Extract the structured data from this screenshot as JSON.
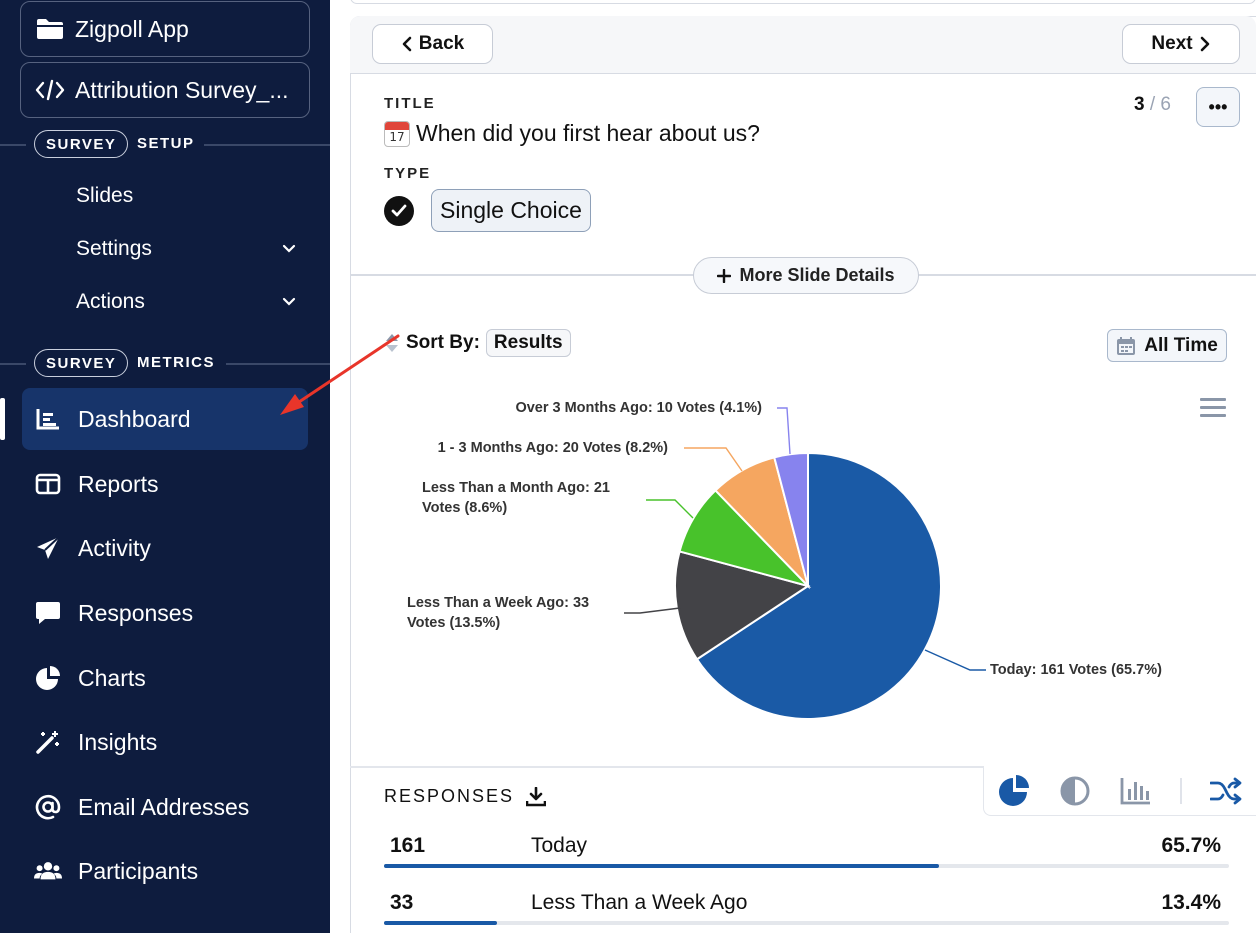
{
  "sidebar": {
    "app_name": "Zigpoll App",
    "survey_name": "Attribution Survey_...",
    "setup_section": {
      "pill": "SURVEY",
      "label": "SETUP"
    },
    "setup_items": [
      {
        "label": "Slides",
        "chevron": false
      },
      {
        "label": "Settings",
        "chevron": true
      },
      {
        "label": "Actions",
        "chevron": true
      }
    ],
    "metrics_section": {
      "pill": "SURVEY",
      "label": "METRICS"
    },
    "nav": [
      {
        "label": "Dashboard",
        "icon": "dashboard-icon",
        "active": true
      },
      {
        "label": "Reports",
        "icon": "reports-icon"
      },
      {
        "label": "Activity",
        "icon": "paper-plane-icon"
      },
      {
        "label": "Responses",
        "icon": "speech-bubble-icon"
      },
      {
        "label": "Charts",
        "icon": "pie-chart-icon"
      },
      {
        "label": "Insights",
        "icon": "magic-wand-icon"
      },
      {
        "label": "Email Addresses",
        "icon": "at-sign-icon"
      },
      {
        "label": "Participants",
        "icon": "users-icon"
      }
    ]
  },
  "header": {
    "back_label": "Back",
    "next_label": "Next"
  },
  "slide": {
    "title_label": "TITLE",
    "title_icon_text": "17",
    "title": "When did you first hear about us?",
    "type_label": "TYPE",
    "type_value": "Single Choice",
    "position": "3",
    "total": "/ 6",
    "more_menu": "•••",
    "more_details": "More Slide Details"
  },
  "sort": {
    "label": "Sort By:",
    "value": "Results"
  },
  "time_filter": "All Time",
  "colors": {
    "sidebar_bg": "#0e1c3e",
    "accent": "#1959a6",
    "slice_today": "#1a5aa6",
    "slice_week": "#434347",
    "slice_month": "#48c22b",
    "slice_1_3": "#f5a660",
    "slice_over3": "#8783ee",
    "annotation_arrow": "#e8352a"
  },
  "chart_data": {
    "type": "pie",
    "slices": [
      {
        "name": "Today",
        "votes": 161,
        "percent": 65.7,
        "label": "Today: 161 Votes (65.7%)",
        "color": "#1a5aa6"
      },
      {
        "name": "Less Than a Week Ago",
        "votes": 33,
        "percent": 13.5,
        "label_lines": [
          "Less Than a Week Ago: 33",
          "Votes (13.5%)"
        ],
        "color": "#434347"
      },
      {
        "name": "Less Than a Month Ago",
        "votes": 21,
        "percent": 8.6,
        "label_lines": [
          "Less Than a Month Ago: 21",
          "Votes (8.6%)"
        ],
        "color": "#48c22b"
      },
      {
        "name": "1 - 3 Months Ago",
        "votes": 20,
        "percent": 8.2,
        "label": "1 - 3 Months Ago: 20 Votes (8.2%)",
        "color": "#f5a660"
      },
      {
        "name": "Over 3 Months Ago",
        "votes": 10,
        "percent": 4.1,
        "label": "Over 3 Months Ago: 10 Votes (4.1%)",
        "color": "#8783ee"
      }
    ]
  },
  "responses": {
    "title": "RESPONSES",
    "rows": [
      {
        "count": "161",
        "name": "Today",
        "percent": "65.7%",
        "fraction": 0.657
      },
      {
        "count": "33",
        "name": "Less Than a Week Ago",
        "percent": "13.4%",
        "fraction": 0.134
      }
    ]
  }
}
